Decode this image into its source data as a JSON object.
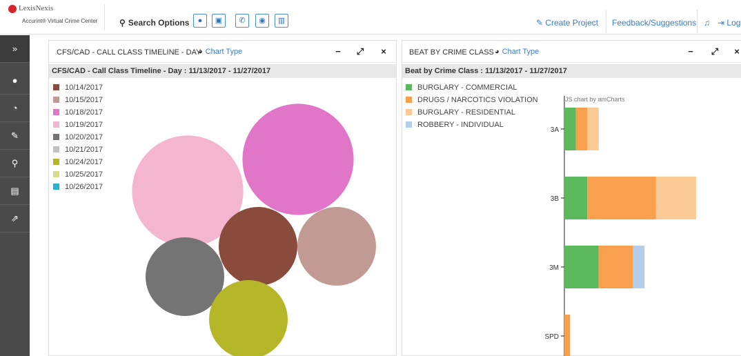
{
  "header": {
    "brand": "LexisNexis",
    "brand_sup": "®",
    "product": "Accurint® Virtual Crime Center",
    "search_label": "Search Options",
    "search_icons": [
      "person-icon",
      "car-icon",
      "phone-icon",
      "badge-icon",
      "building-icon"
    ],
    "create_project": "Create Project",
    "feedback": "Feedback/Suggestions",
    "logout_partial": "Log"
  },
  "sidebar": {
    "items": [
      {
        "icon": "expand-icon",
        "glyph": "»"
      },
      {
        "icon": "person-icon",
        "glyph": "●"
      },
      {
        "icon": "dashboard-icon",
        "glyph": "◔"
      },
      {
        "icon": "edit-icon",
        "glyph": "✎"
      },
      {
        "icon": "search-icon",
        "glyph": "⚲"
      },
      {
        "icon": "document-icon",
        "glyph": "▤"
      },
      {
        "icon": "external-link-icon",
        "glyph": "⇗"
      }
    ]
  },
  "left_panel": {
    "title": "CFS/CAD - CALL CLASS TIMELINE - DAY",
    "chart_type_label": "Chart Type",
    "subtitle": "CFS/CAD - Call Class Timeline - Day : 11/13/2017 - 11/27/2017"
  },
  "right_panel": {
    "title": "BEAT BY CRIME CLASS",
    "chart_type_label": "Chart Type",
    "subtitle": "Beat by Crime Class : 11/13/2017 - 11/27/2017",
    "credit": "JS chart by amCharts"
  },
  "chart_data": [
    {
      "type": "bubble",
      "legend": [
        {
          "label": "10/14/2017",
          "color": "#8a4a3c"
        },
        {
          "label": "10/15/2017",
          "color": "#c09a93"
        },
        {
          "label": "10/18/2017",
          "color": "#e176c9"
        },
        {
          "label": "10/19/2017",
          "color": "#f4b5cf"
        },
        {
          "label": "10/20/2017",
          "color": "#747474"
        },
        {
          "label": "10/21/2017",
          "color": "#c1c1c1"
        },
        {
          "label": "10/24/2017",
          "color": "#b5b628"
        },
        {
          "label": "10/25/2017",
          "color": "#d6dc88"
        },
        {
          "label": "10/26/2017",
          "color": "#26b4cc"
        }
      ],
      "bubbles": [
        {
          "label": "10/19/2017",
          "color": "#f4b5cf",
          "value": 6.6
        },
        {
          "label": "10/18/2017",
          "color": "#e176c9",
          "value": 6.6
        },
        {
          "label": "10/14/2017",
          "color": "#8a4a3c",
          "value": 3.3
        },
        {
          "label": "10/15/2017",
          "color": "#c09a93",
          "value": 3.3
        },
        {
          "label": "10/20/2017",
          "color": "#747474",
          "value": 3.3
        },
        {
          "label": "10/24/2017",
          "color": "#b5b628",
          "value": 3.3
        }
      ]
    },
    {
      "type": "bar",
      "orientation": "horizontal",
      "stacked": true,
      "categories": [
        "3A",
        "3B",
        "3M",
        "SPD"
      ],
      "series": [
        {
          "name": "BURGLARY - COMMERCIAL",
          "color": "#5cb85c",
          "values": [
            1,
            2,
            3,
            0
          ]
        },
        {
          "name": "DRUGS / NARCOTICS VIOLATION",
          "color": "#f9a04e",
          "values": [
            1,
            6,
            3,
            0.5
          ]
        },
        {
          "name": "BURGLARY - RESIDENTIAL",
          "color": "#fccb95",
          "values": [
            1,
            3.5,
            0,
            0
          ]
        },
        {
          "name": "ROBBERY - INDIVIDUAL",
          "color": "#b7cdec",
          "values": [
            0,
            0,
            1,
            0
          ]
        }
      ]
    }
  ]
}
